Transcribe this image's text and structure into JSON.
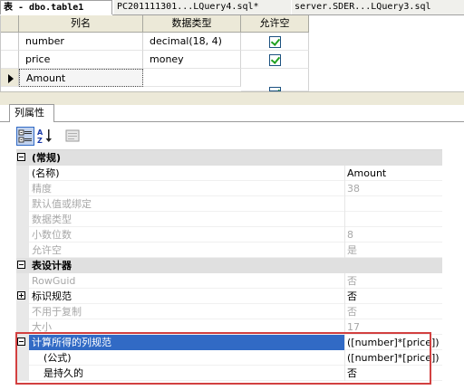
{
  "tabs": [
    {
      "label": "表 - dbo.table1"
    },
    {
      "label": "PC201111301...LQuery4.sql*"
    },
    {
      "label": "server.SDER...LQuery3.sql"
    }
  ],
  "grid": {
    "headers": [
      "列名",
      "数据类型",
      "允许空"
    ],
    "rows": [
      {
        "name": "number",
        "type": "decimal(18, 4)",
        "allow_null": true
      },
      {
        "name": "price",
        "type": "money",
        "allow_null": true
      },
      {
        "name": "Amount",
        "type": "",
        "allow_null": true
      }
    ]
  },
  "properties_tab": {
    "label": "列属性"
  },
  "toolbar": {
    "categorized_icon": "categorized-icon",
    "sort_az_icon": "sort-az-icon",
    "property_pages_icon": "property-pages-icon"
  },
  "properties": [
    {
      "kind": "category",
      "name": "(常规)",
      "expander": "minus"
    },
    {
      "name": "(名称)",
      "value": "Amount",
      "dim": false
    },
    {
      "name": "精度",
      "value": "38",
      "dim": true
    },
    {
      "name": "默认值或绑定",
      "value": "",
      "dim": true
    },
    {
      "name": "数据类型",
      "value": "",
      "dim": true
    },
    {
      "name": "小数位数",
      "value": "8",
      "dim": true
    },
    {
      "name": "允许空",
      "value": "是",
      "dim": true
    },
    {
      "kind": "category",
      "name": "表设计器",
      "expander": "minus"
    },
    {
      "name": "RowGuid",
      "value": "否",
      "dim": true
    },
    {
      "name": "标识规范",
      "value": "否",
      "dim": false,
      "expander": "plus"
    },
    {
      "name": "不用于复制",
      "value": "否",
      "dim": true
    },
    {
      "name": "大小",
      "value": "17",
      "dim": true
    },
    {
      "name": "计算所得的列规范",
      "value": "([number]*[price])",
      "dim": false,
      "expander": "minus",
      "selected": true
    },
    {
      "name": "(公式)",
      "value": "([number]*[price])",
      "dim": false,
      "indent": true
    },
    {
      "name": "是持久的",
      "value": "否",
      "dim": false,
      "indent": true
    }
  ],
  "colors": {
    "selection": "#316ac5",
    "highlight_box": "#d24040",
    "check": "#21a121"
  }
}
